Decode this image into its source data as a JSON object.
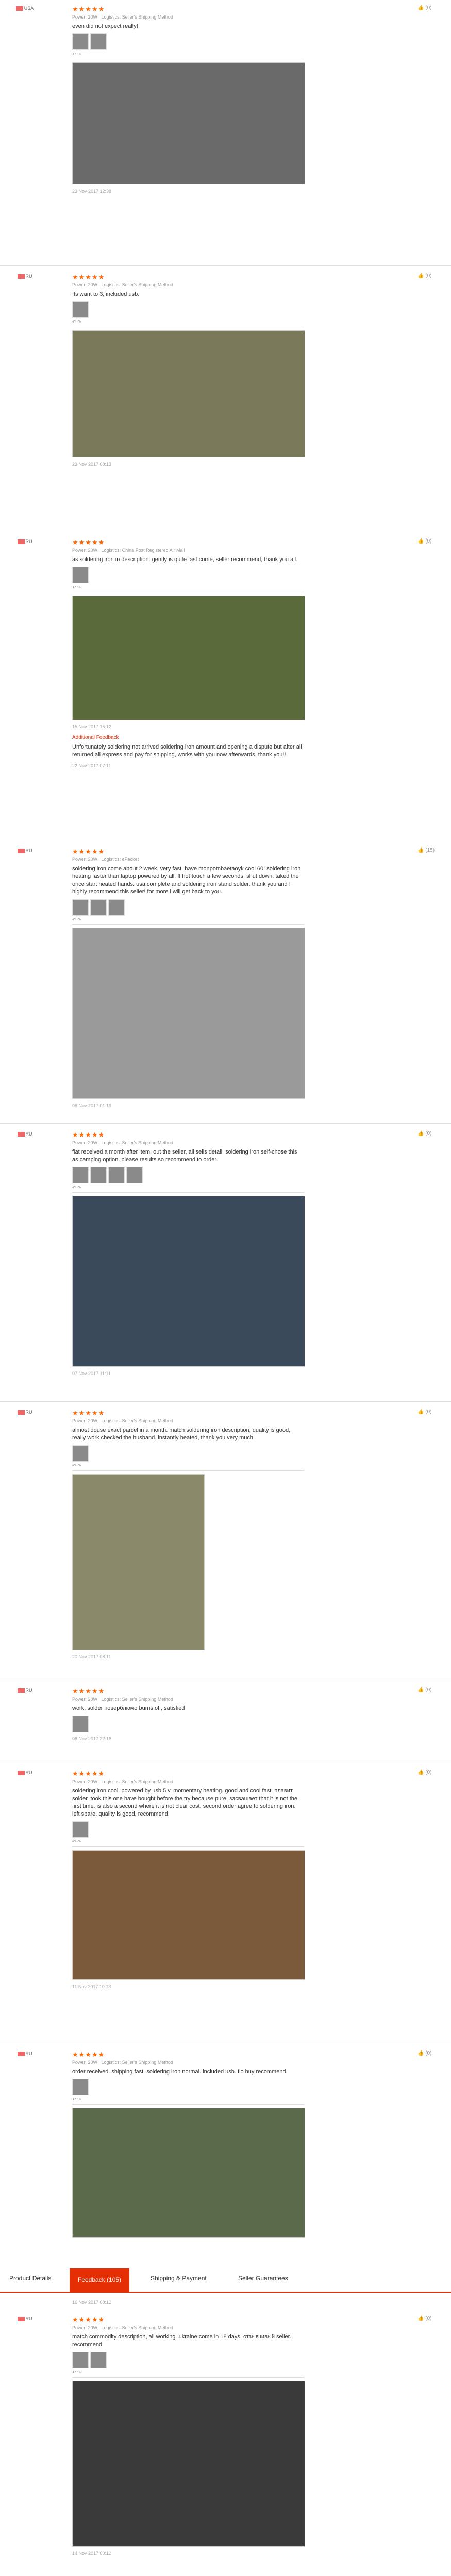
{
  "reviews": [
    {
      "user": "",
      "country": "USA",
      "stars": "★★★★★",
      "power": "Power: 20W",
      "logistics": "Logistics: Seller's Shipping Method",
      "text": "even did not expect really!",
      "date": "23 Nov 2017 12:38",
      "helpful": "(0)"
    },
    {
      "user": "",
      "country": "RU",
      "stars": "★★★★★",
      "power": "Power: 20W",
      "logistics": "Logistics: Seller's Shipping Method",
      "text": "Its want to 3, included usb.",
      "date": "23 Nov 2017 08:13",
      "helpful": "(0)"
    },
    {
      "user": "",
      "country": "RU",
      "stars": "★★★★★",
      "power": "Power: 20W",
      "logistics": "Logistics: China Post Registered Air Mail",
      "text": "as soldering iron in description: gently is quite fast come, seller recommend, thank you all.",
      "date": "15 Nov 2017 15:12",
      "additional_label": "Additional Feedback",
      "additional_text": "Unfortunately soldering not arrived soldering iron amount and opening a dispute but after all returned all express and pay for shipping, works with you now afterwards. thank you!!",
      "additional_date": "22 Nov 2017 07:11",
      "helpful": "(0)"
    },
    {
      "user": "",
      "country": "RU",
      "stars": "★★★★★",
      "power": "Power: 20W",
      "logistics": "Logistics: ePacket",
      "text": "soldering iron come about 2 week. very fast. have monpotnbaetaoyk cool 60! soldering iron heating faster than laptop powered by all. If hot touch a few seconds, shut down. taked the once start heated hands. usa complete and soldering iron stand solder. thank you and I highly recommend this seller! for more i will get back to you.",
      "date": "08 Nov 2017 01:19",
      "helpful": "(15)"
    },
    {
      "user": "",
      "country": "RU",
      "stars": "★★★★★",
      "power": "Power: 20W",
      "logistics": "Logistics: Seller's Shipping Method",
      "text": "flat received a month after item, out the seller, all sells detail. soldering iron self-chose this as camping option. please results so recommend to order.",
      "date": "07 Nov 2017 11:11",
      "helpful": "(0)"
    },
    {
      "user": "",
      "country": "RU",
      "stars": "★★★★★",
      "power": "Power: 20W",
      "logistics": "Logistics: Seller's Shipping Method",
      "text": "almost douse exact parcel in a month. match soldering iron description, quality is good, really work checked the husband. instantly heated, thank you very much",
      "date": "20 Nov 2017 08:11",
      "helpful": "(0)"
    },
    {
      "user": "",
      "country": "RU",
      "stars": "★★★★★",
      "power": "Power: 20W",
      "logistics": "Logistics: Seller's Shipping Method",
      "text": "work, solder поверблюмо burns off, satisfied",
      "date": "06 Nov 2017 22:18",
      "helpful": "(0)"
    },
    {
      "user": "",
      "country": "RU",
      "stars": "★★★★★",
      "power": "Power: 20W",
      "logistics": "Logistics: Seller's Shipping Method",
      "text": "soldering iron cool. powered by usb 5 v, momentary heating. good and cool fast. плавит solder. took this one have bought before the try because pure, засвашает that it is not the first time. is also a second where it is not clear cost. second order agree to soldering iron. left spare. quality is good, recommend.",
      "date": "11 Nov 2017 10:13",
      "helpful": "(0)"
    },
    {
      "user": "",
      "country": "RU",
      "stars": "★★★★★",
      "power": "Power: 20W",
      "logistics": "Logistics: Seller's Shipping Method",
      "text": "order received. shipping fast. soldering iron normal. included usb. Ilo buy recommend.",
      "date": "16 Nov 2017 08:12",
      "helpful": "(0)"
    },
    {
      "user": "",
      "country": "RU",
      "stars": "★★★★★",
      "power": "Power: 20W",
      "logistics": "Logistics: Seller's Shipping Method",
      "text": "match commodity description, all working. ukraine come in 18 days. отзывчивый seller. recommend",
      "date": "14 Nov 2017 08:12",
      "helpful": "(0)"
    }
  ],
  "tabs": {
    "t1": "Product Details",
    "t2": "Feedback (105)",
    "t3": "Shipping & Payment",
    "t4": "Seller Guarantees"
  },
  "icons": {
    "thumbs_up": "thumbs-up-icon",
    "thumbs_down": "thumbs-down-icon",
    "like": "like-icon"
  },
  "colors": {
    "accent": "#e62e04",
    "stars": "#ff6600"
  }
}
